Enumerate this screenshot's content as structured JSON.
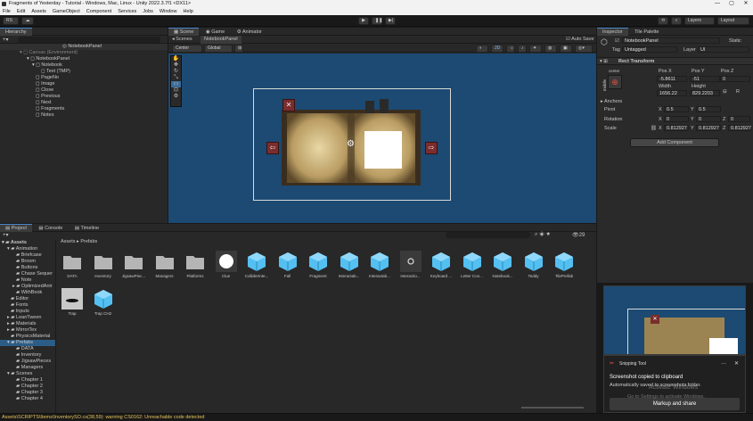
{
  "window": {
    "title": "Fragments of Yesterday - Tutorial - Windows, Mac, Linux - Unity 2022.3.7f1 <DX11>",
    "controls": [
      "—",
      "▢",
      "✕"
    ]
  },
  "menu": [
    "File",
    "Edit",
    "Assets",
    "GameObject",
    "Component",
    "Services",
    "Jobs",
    "Window",
    "Help"
  ],
  "toolbar": {
    "account": "RS",
    "layers": "Layers",
    "layout": "Layout"
  },
  "hierarchy": {
    "tab": "Hierarchy",
    "scene": "NotebookPanel",
    "items": [
      {
        "label": "Canvas (Environment)"
      },
      {
        "label": "NotebookPanel"
      },
      {
        "label": "Notebook"
      },
      {
        "label": "Text (TMP)"
      },
      {
        "label": "PageNo"
      },
      {
        "label": "Image"
      },
      {
        "label": "Close"
      },
      {
        "label": "Previous"
      },
      {
        "label": "Next"
      },
      {
        "label": "Fragments"
      },
      {
        "label": "Notes"
      }
    ]
  },
  "scene": {
    "tabs": [
      "Scene",
      "Game",
      "Animator"
    ],
    "breadcrumb": [
      "Scenes",
      "NotebookPanel"
    ],
    "auto_save": "Auto Save",
    "pivot": "Center",
    "space": "Global",
    "mode_2d": "2D",
    "accent": "#1c4a73"
  },
  "inspector": {
    "tabs": [
      "Inspector",
      "Tile Palette"
    ],
    "object_name": "NotebookPanel",
    "static_label": "Static",
    "tag_label": "Tag",
    "tag_value": "Untagged",
    "layer_label": "Layer",
    "layer_value": "UI",
    "component": "Rect Transform",
    "anchor_mode": "center",
    "side_mode": "middle",
    "pos_x_label": "Pos X",
    "pos_y_label": "Pos Y",
    "pos_z_label": "Pos Z",
    "pos_x": "-5.8611",
    "pos_y": "-51",
    "pos_z": "0",
    "width_label": "Width",
    "height_label": "Height",
    "width": "1656.22",
    "height": "829.2203",
    "anchors": "Anchors",
    "pivot": "Pivot",
    "pivot_x": "0.5",
    "pivot_y": "0.5",
    "rotation": "Rotation",
    "rot_x": "0",
    "rot_y": "0",
    "rot_z": "0",
    "scale": "Scale",
    "scale_x": "0.812927",
    "scale_y": "0.812927",
    "scale_z": "0.812927",
    "add_component": "Add Component"
  },
  "bottom_tabs": [
    "Project",
    "Console",
    "Timeline"
  ],
  "project_tree": {
    "root": "Assets",
    "items": [
      "Animation",
      "Briefcase",
      "Broom",
      "Buttons",
      "Chase Sequer",
      "Note",
      "OptimizedAnir",
      "WithBook",
      "Editor",
      "Fonts",
      "Inputs",
      "LeanTween",
      "Materials",
      "MirrorTex",
      "PhysicsMaterial",
      "Prefabs",
      "DATA",
      "Inventory",
      "JigsawPieces",
      "Managers",
      "Scenes",
      "Chapter 1",
      "Chapter 2",
      "Chapter 3",
      "Chapter 4"
    ]
  },
  "project_breadcrumb": [
    "Assets",
    "Prefabs"
  ],
  "assets": [
    {
      "label": "DATA",
      "kind": "folder"
    },
    {
      "label": "Inventory",
      "kind": "folder"
    },
    {
      "label": "JigsawPiec...",
      "kind": "folder"
    },
    {
      "label": "Managers",
      "kind": "folder"
    },
    {
      "label": "Platforms",
      "kind": "folder"
    },
    {
      "label": "Clue",
      "kind": "circle"
    },
    {
      "label": "ColliderInte...",
      "kind": "cube"
    },
    {
      "label": "Fall",
      "kind": "cube"
    },
    {
      "label": "Fragment",
      "kind": "cube"
    },
    {
      "label": "Interactab...",
      "kind": "cube"
    },
    {
      "label": "Interactab...",
      "kind": "cube"
    },
    {
      "label": "Interactio...",
      "kind": "ring"
    },
    {
      "label": "Keyboard ...",
      "kind": "cube"
    },
    {
      "label": "Letter Con...",
      "kind": "cube"
    },
    {
      "label": "Notebook...",
      "kind": "cube"
    },
    {
      "label": "Teddy",
      "kind": "cube"
    },
    {
      "label": "TilePrefab",
      "kind": "cube"
    },
    {
      "label": "Trap",
      "kind": "dark"
    },
    {
      "label": "Trap CH2",
      "kind": "cube"
    }
  ],
  "asset_count": "29",
  "status": "Assets\\SCRIPTS\\Items\\InventorySO.cs(38,59): warning CS0162: Unreachable code detected",
  "toast": {
    "app": "Snipping Tool",
    "title": "Screenshot copied to clipboard",
    "body": "Automatically saved to screenshots folder.",
    "action": "Markup and share",
    "watermark1": "Activate Windows",
    "watermark2": "Go to Settings to activate Windows."
  }
}
